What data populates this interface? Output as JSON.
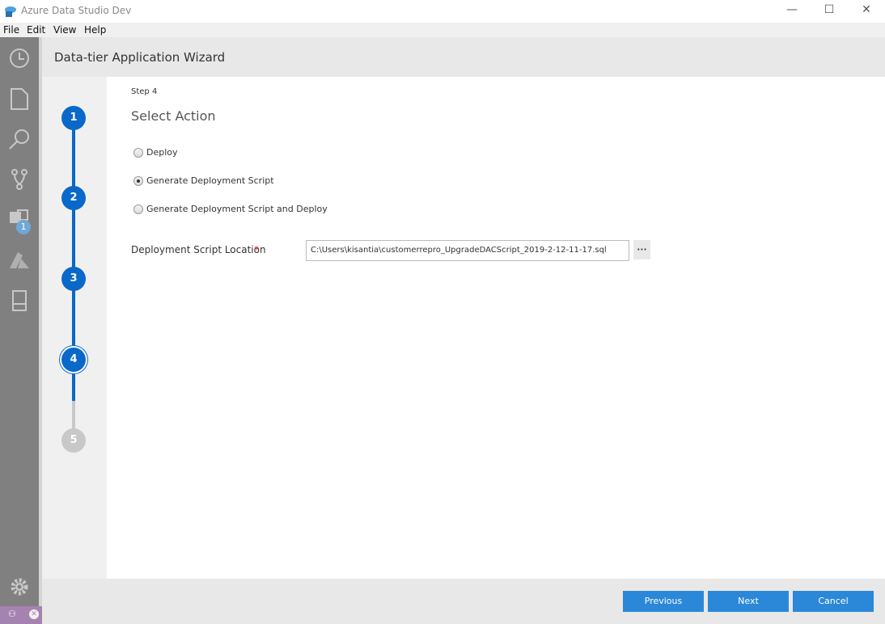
{
  "window": {
    "title": "Azure Data Studio Dev"
  },
  "menu": [
    "File",
    "Edit",
    "View",
    "Help"
  ],
  "activity": {
    "badge": "1"
  },
  "wizard": {
    "title": "Data-tier Application Wizard",
    "step_label": "Step 4",
    "page_title": "Select Action",
    "steps": [
      "1",
      "2",
      "3",
      "4",
      "5"
    ],
    "current_step": 4,
    "options": [
      {
        "label": "Deploy",
        "checked": false
      },
      {
        "label": "Generate Deployment Script",
        "checked": true
      },
      {
        "label": "Generate Deployment Script and Deploy",
        "checked": false
      }
    ],
    "location_label": "Deployment Script Location",
    "required_mark": "*",
    "location_value": "C:\\Users\\kisantia\\customerrepro_UpgradeDACScript_2019-2-12-11-17.sql",
    "browse_label": "•••"
  },
  "footer": {
    "previous": "Previous",
    "next": "Next",
    "cancel": "Cancel"
  },
  "colors": {
    "accent": "#0a68c9",
    "button": "#2b88d8",
    "status": "#a583b0"
  }
}
